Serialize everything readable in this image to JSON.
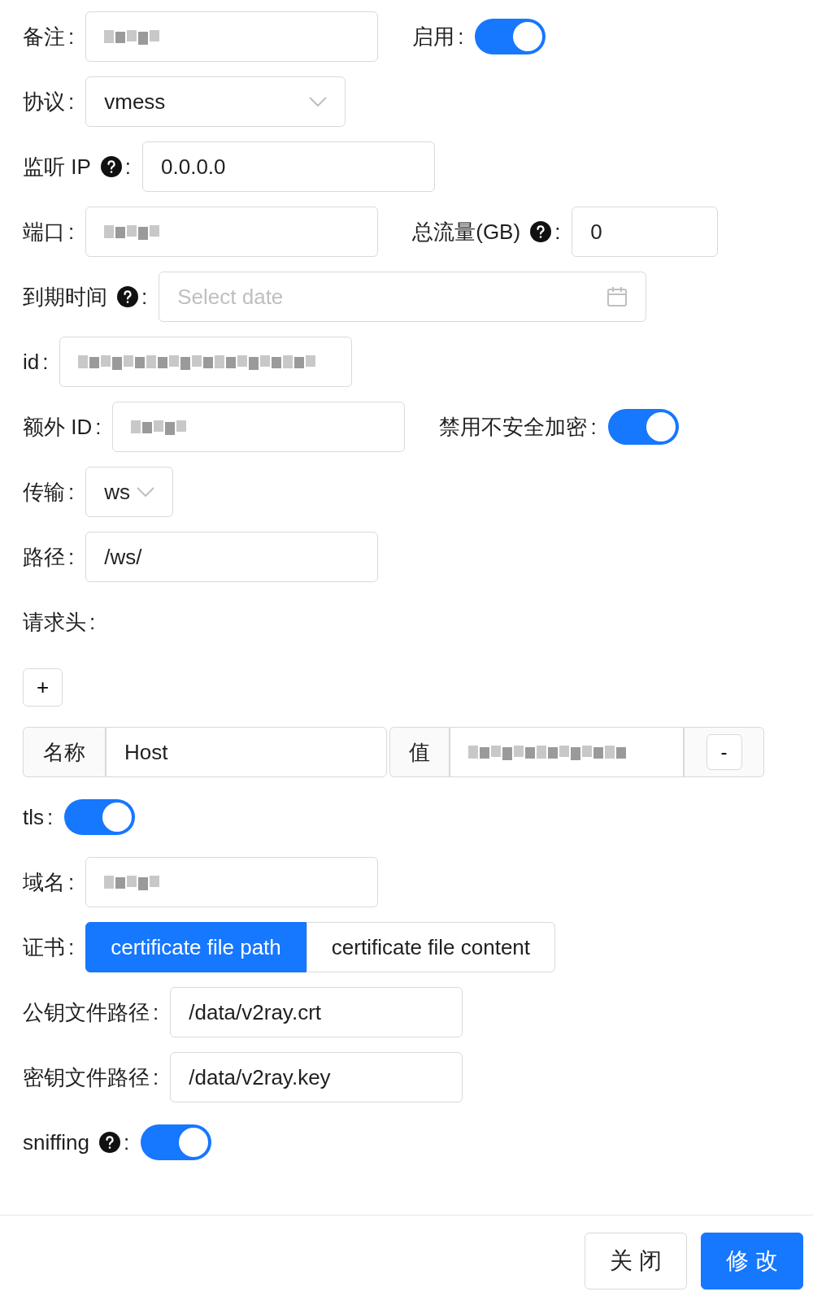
{
  "rows": [
    {
      "items": [
        {
          "kind": "input",
          "label": "备注",
          "colon": ":",
          "redacted": true
        },
        {
          "kind": "switch",
          "label": "启用",
          "colon": ":",
          "on": true
        }
      ]
    },
    {
      "items": [
        {
          "kind": "select",
          "label": "协议",
          "colon": ":",
          "value": "vmess"
        }
      ]
    },
    {
      "items": [
        {
          "kind": "input",
          "label": "监听 IP",
          "help": true,
          "colon": ":",
          "value": "0.0.0.0"
        }
      ]
    },
    {
      "items": [
        {
          "kind": "input",
          "label": "端口",
          "colon": ":",
          "redacted": true
        },
        {
          "kind": "input",
          "label": "总流量(GB)",
          "help": true,
          "colon": ":",
          "value": "0"
        }
      ]
    },
    {
      "items": [
        {
          "kind": "date",
          "label": "到期时间",
          "help": true,
          "colon": ":",
          "placeholder": "Select date"
        }
      ]
    },
    {
      "items": [
        {
          "kind": "input",
          "label": "id",
          "colon": ":",
          "redacted": true
        }
      ]
    },
    {
      "items": [
        {
          "kind": "input",
          "label": "额外 ID",
          "colon": ":",
          "redacted": true
        },
        {
          "kind": "switch",
          "label": "禁用不安全加密",
          "colon": ":",
          "on": true
        }
      ]
    },
    {
      "items": [
        {
          "kind": "select",
          "label": "传输",
          "colon": ":",
          "value": "ws"
        }
      ]
    },
    {
      "items": [
        {
          "kind": "input",
          "label": "路径",
          "colon": ":",
          "value": "/ws/"
        }
      ]
    },
    {
      "items": [
        {
          "kind": "label",
          "label": "请求头",
          "colon": ":"
        }
      ]
    },
    {
      "items": [
        {
          "kind": "add",
          "symbol": "+"
        }
      ]
    },
    {
      "items": [
        {
          "kind": "header",
          "name_label": "名称",
          "name": "Host",
          "value_label": "值",
          "redacted": true,
          "remove": "-"
        }
      ]
    },
    {
      "items": [
        {
          "kind": "switch",
          "label": "tls",
          "colon": ":",
          "on": true
        }
      ]
    },
    {
      "items": [
        {
          "kind": "input",
          "label": "域名",
          "colon": ":",
          "redacted": true
        }
      ]
    },
    {
      "items": [
        {
          "kind": "radio",
          "label": "证书",
          "colon": ":",
          "options": [
            {
              "label": "certificate file path",
              "selected": true
            },
            {
              "label": "certificate file content",
              "selected": false
            }
          ]
        }
      ]
    },
    {
      "items": [
        {
          "kind": "input",
          "label": "公钥文件路径",
          "colon": ":",
          "value": "/data/v2ray.crt"
        }
      ]
    },
    {
      "items": [
        {
          "kind": "input",
          "label": "密钥文件路径",
          "colon": ":",
          "value": "/data/v2ray.key"
        }
      ]
    },
    {
      "items": [
        {
          "kind": "switch",
          "label": "sniffing",
          "help": true,
          "colon": ":",
          "on": true
        }
      ]
    }
  ],
  "footer": {
    "buttons": [
      {
        "label": "关 闭",
        "kind": "default"
      },
      {
        "label": "修 改",
        "kind": "primary"
      }
    ]
  }
}
